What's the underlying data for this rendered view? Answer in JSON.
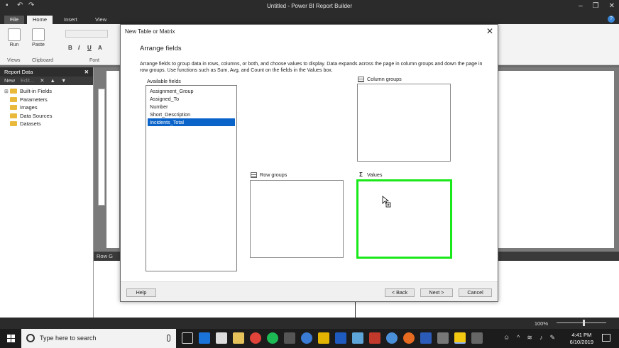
{
  "app": {
    "title": "Untitled - Power BI Report Builder",
    "tabs": [
      "File",
      "Home",
      "Insert",
      "View"
    ],
    "ribbon": {
      "run_label": "Run",
      "paste_label": "Paste",
      "groups": [
        "Views",
        "Clipboard",
        "Font"
      ],
      "format_buttons": [
        "B",
        "I",
        "U",
        "A"
      ]
    }
  },
  "report_data": {
    "title": "Report Data",
    "toolbar": {
      "new_label": "New",
      "edit_label": "Edit..."
    },
    "items": [
      {
        "label": "Built-in Fields",
        "expandable": true
      },
      {
        "label": "Parameters",
        "expandable": false
      },
      {
        "label": "Images",
        "expandable": false
      },
      {
        "label": "Data Sources",
        "expandable": false
      },
      {
        "label": "Datasets",
        "expandable": false
      }
    ]
  },
  "groups_bar": {
    "label": "Row G"
  },
  "status": {
    "zoom": "100%"
  },
  "dialog": {
    "title": "New Table or Matrix",
    "heading": "Arrange fields",
    "description": "Arrange fields to group data in rows, columns, or both, and choose values to display. Data expands across the page in column groups and down the page in row groups.  Use functions such as Sum, Avg, and Count on the fields in the Values box.",
    "available_label": "Available fields",
    "fields": [
      "Assignment_Group",
      "Assigned_To",
      "Number",
      "Short_Description",
      "Incidents_Total"
    ],
    "selected_field_index": 4,
    "column_groups_label": "Column groups",
    "row_groups_label": "Row groups",
    "values_label": "Values",
    "values_symbol": "Σ",
    "buttons": {
      "help": "Help",
      "back": "< Back",
      "next": "Next >",
      "cancel": "Cancel"
    },
    "highlight_color": "#19e819"
  },
  "taskbar": {
    "search_placeholder": "Type here to search",
    "time": "4:41 PM",
    "date": "6/10/2019"
  }
}
